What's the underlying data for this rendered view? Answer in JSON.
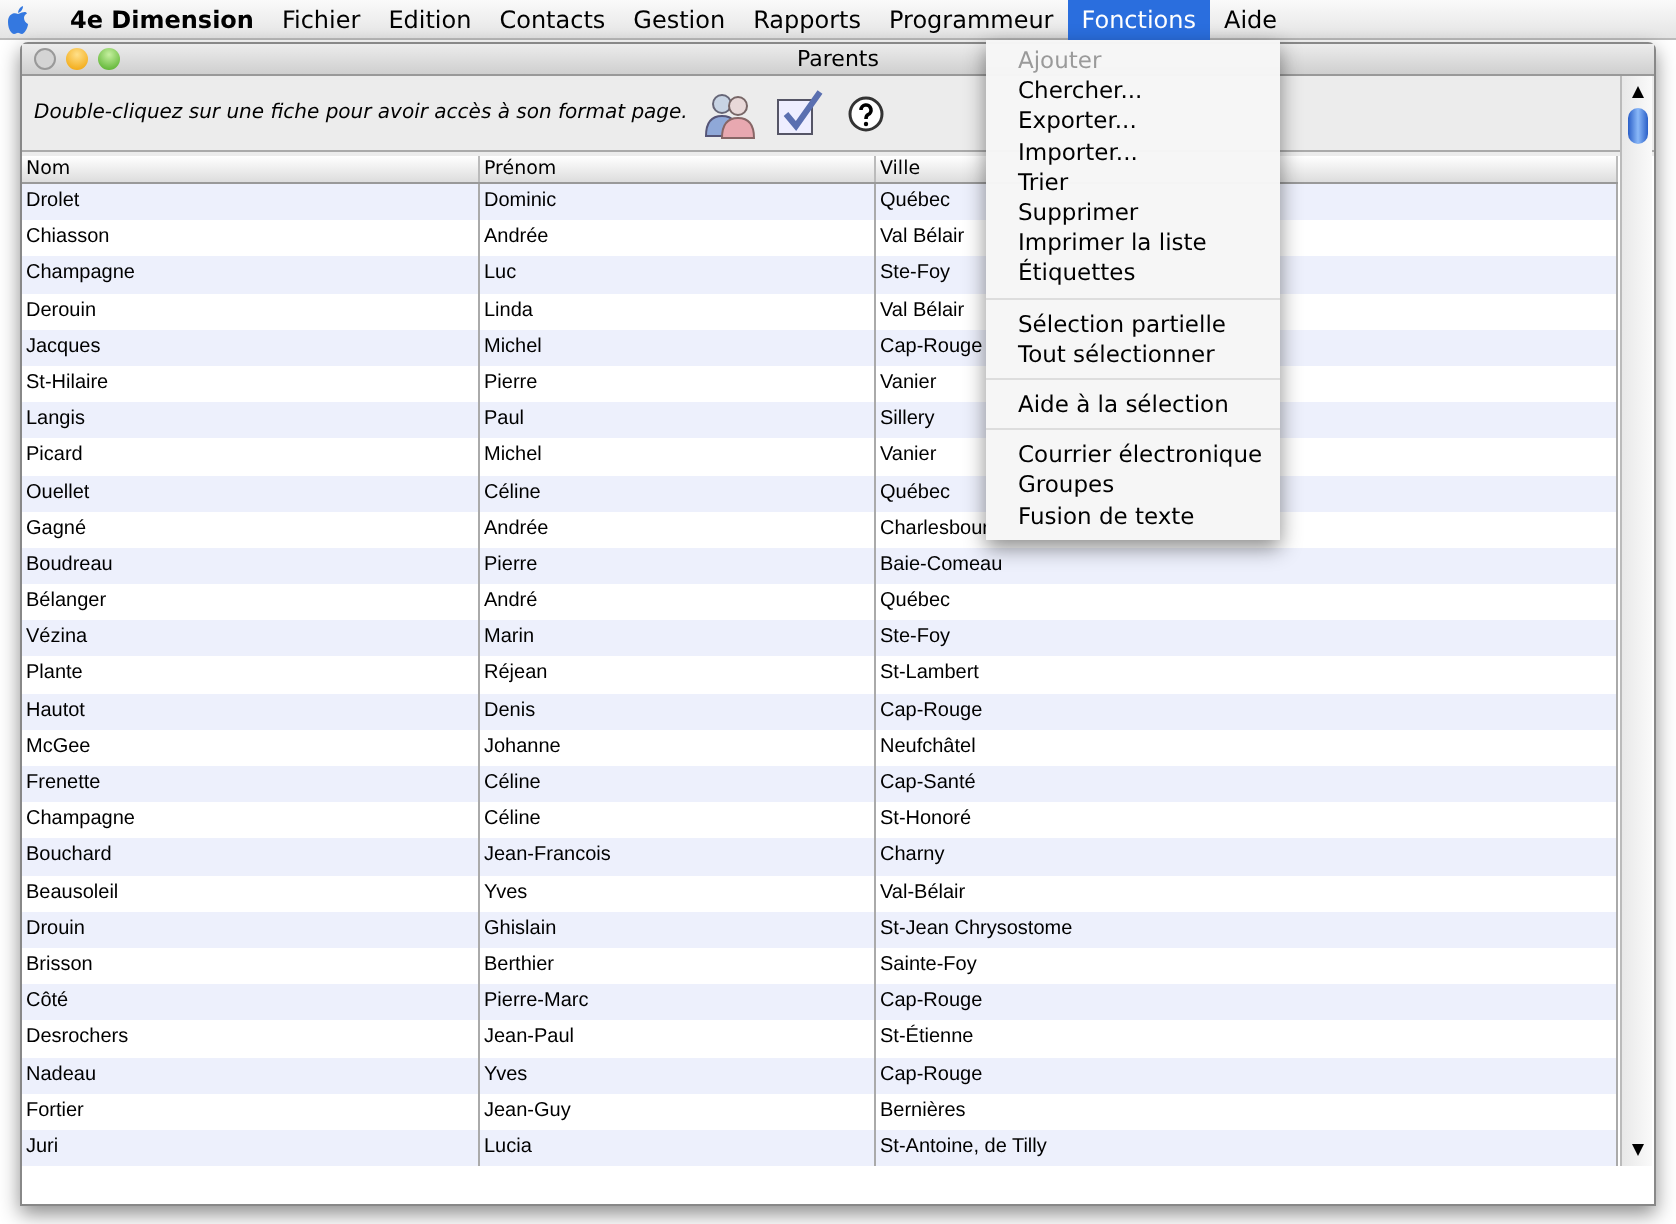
{
  "menu_bar": [
    {
      "label": "4e Dimension",
      "kind": "app",
      "selected": false
    },
    {
      "label": "Fichier",
      "kind": "menu",
      "selected": false
    },
    {
      "label": "Edition",
      "kind": "menu",
      "selected": false
    },
    {
      "label": "Contacts",
      "kind": "menu",
      "selected": false
    },
    {
      "label": "Gestion",
      "kind": "menu",
      "selected": false
    },
    {
      "label": "Rapports",
      "kind": "menu",
      "selected": false
    },
    {
      "label": "Programmeur",
      "kind": "menu",
      "selected": false
    },
    {
      "label": "Fonctions",
      "kind": "menu",
      "selected": true
    },
    {
      "label": "Aide",
      "kind": "menu",
      "selected": false
    }
  ],
  "window": {
    "title": "Parents",
    "hint": "Double-cliquez sur une fiche pour avoir accès à son format page."
  },
  "table": {
    "columns": [
      "Nom",
      "Prénom",
      "Ville"
    ],
    "rows": [
      [
        "Drolet",
        "Dominic",
        "Québec"
      ],
      [
        "Chiasson",
        "Andrée",
        "Val Bélair"
      ],
      [
        "Champagne",
        "Luc",
        "Ste-Foy"
      ],
      [
        "Derouin",
        "Linda",
        "Val Bélair"
      ],
      [
        "Jacques",
        "Michel",
        "Cap-Rouge"
      ],
      [
        "St-Hilaire",
        "Pierre",
        "Vanier"
      ],
      [
        "Langis",
        "Paul",
        "Sillery"
      ],
      [
        "Picard",
        "Michel",
        "Vanier"
      ],
      [
        "Ouellet",
        "Céline",
        "Québec"
      ],
      [
        "Gagné",
        "Andrée",
        "Charlesbour"
      ],
      [
        "Boudreau",
        "Pierre",
        "Baie-Comeau"
      ],
      [
        "Bélanger",
        "André",
        "Québec"
      ],
      [
        "Vézina",
        "Marin",
        "Ste-Foy"
      ],
      [
        "Plante",
        "Réjean",
        "St-Lambert"
      ],
      [
        "Hautot",
        "Denis",
        "Cap-Rouge"
      ],
      [
        "McGee",
        "Johanne",
        "Neufchâtel"
      ],
      [
        "Frenette",
        "Céline",
        "Cap-Santé"
      ],
      [
        "Champagne",
        "Céline",
        "St-Honoré"
      ],
      [
        "Bouchard",
        "Jean-Francois",
        "Charny"
      ],
      [
        "Beausoleil",
        "Yves",
        "Val-Bélair"
      ],
      [
        "Drouin",
        "Ghislain",
        "St-Jean Chrysostome"
      ],
      [
        "Brisson",
        "Berthier",
        "Sainte-Foy"
      ],
      [
        "Côté",
        "Pierre-Marc",
        "Cap-Rouge"
      ],
      [
        "Desrochers",
        "Jean-Paul",
        "St-Étienne"
      ],
      [
        "Nadeau",
        "Yves",
        "Cap-Rouge"
      ],
      [
        "Fortier",
        "Jean-Guy",
        "Bernières"
      ],
      [
        "Juri",
        "Lucia",
        "St-Antoine, de Tilly"
      ]
    ]
  },
  "dropdown_menu": [
    {
      "kind": "item",
      "label": "Ajouter",
      "disabled": true
    },
    {
      "kind": "item",
      "label": "Chercher...",
      "disabled": false
    },
    {
      "kind": "item",
      "label": "Exporter...",
      "disabled": false
    },
    {
      "kind": "item",
      "label": "Importer...",
      "disabled": false
    },
    {
      "kind": "item",
      "label": "Trier",
      "disabled": false
    },
    {
      "kind": "item",
      "label": "Supprimer",
      "disabled": false
    },
    {
      "kind": "item",
      "label": "Imprimer la liste",
      "disabled": false
    },
    {
      "kind": "item",
      "label": "Étiquettes",
      "disabled": false
    },
    {
      "kind": "separator"
    },
    {
      "kind": "item",
      "label": "Sélection partielle",
      "disabled": false
    },
    {
      "kind": "item",
      "label": "Tout sélectionner",
      "disabled": false
    },
    {
      "kind": "separator"
    },
    {
      "kind": "item",
      "label": "Aide à la sélection",
      "disabled": false
    },
    {
      "kind": "separator"
    },
    {
      "kind": "item",
      "label": "Courrier électronique",
      "disabled": false
    },
    {
      "kind": "item",
      "label": "Groupes",
      "disabled": false
    },
    {
      "kind": "item",
      "label": "Fusion de texte",
      "disabled": false
    }
  ]
}
